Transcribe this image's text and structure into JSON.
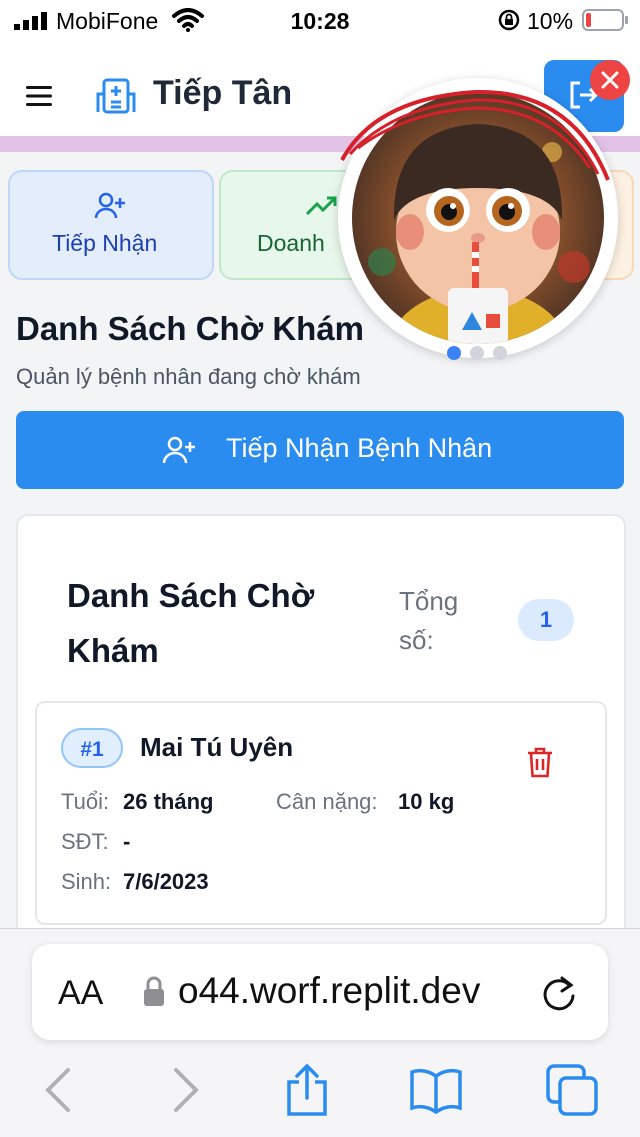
{
  "status_bar": {
    "carrier": "MobiFone",
    "time": "10:28",
    "battery": "10%"
  },
  "header": {
    "title": "Tiếp Tân"
  },
  "nav": {
    "reception": "Tiếp Nhận",
    "revenue": "Doanh"
  },
  "page": {
    "title": "Danh Sách Chờ Khám",
    "subtitle": "Quản lý bệnh nhân đang chờ khám",
    "primary_button": "Tiếp Nhận Bệnh Nhân"
  },
  "list": {
    "title": "Danh Sách Chờ Khám",
    "total_label": "Tổng số:",
    "total_count": "1"
  },
  "patient": {
    "queue_no": "#1",
    "name": "Mai Tú Uyên",
    "age_label": "Tuổi:",
    "age_value": "26 tháng",
    "weight_label": "Cân nặng:",
    "weight_value": "10 kg",
    "phone_label": "SĐT:",
    "phone_value": "-",
    "dob_label": "Sinh:",
    "dob_value": "7/6/2023"
  },
  "browser": {
    "aa": "AA",
    "url": "o44.worf.replit.dev"
  },
  "colors": {
    "primary": "#2b8cef",
    "danger": "#dc2626",
    "green": "#16a34a"
  },
  "icons": [
    "menu-icon",
    "hospital-icon",
    "logout-icon",
    "close-icon",
    "user-plus-icon",
    "trend-up-icon",
    "trash-icon",
    "lock-icon",
    "reload-icon",
    "back-icon",
    "forward-icon",
    "share-icon",
    "bookmarks-icon",
    "tabs-icon"
  ]
}
